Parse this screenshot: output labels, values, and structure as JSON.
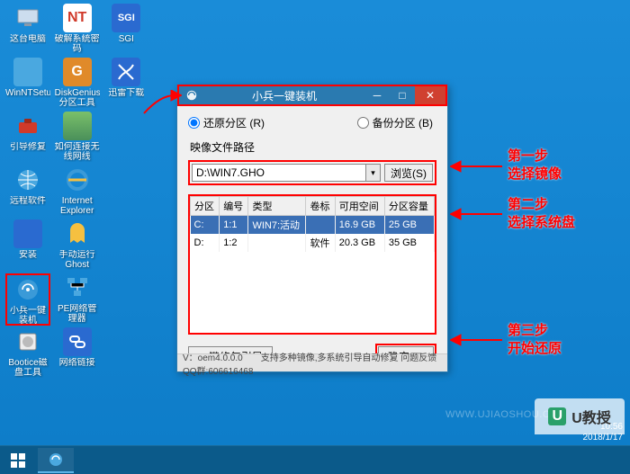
{
  "desktop_icons": [
    {
      "name": "this-pc",
      "label": "这台电脑",
      "glyph": "pc"
    },
    {
      "name": "winntsetup",
      "label": "WinNTSetup",
      "glyph": "blue"
    },
    {
      "name": "boot-repair",
      "label": "引导修复",
      "glyph": "toolbox"
    },
    {
      "name": "remote-soft",
      "label": "远程软件",
      "glyph": "globe"
    },
    {
      "name": "install",
      "label": "安装",
      "glyph": "win7"
    },
    {
      "name": "xiaobing",
      "label": "小兵一键装机",
      "glyph": "xb"
    },
    {
      "name": "bootice",
      "label": "Bootice磁盘工具",
      "glyph": "disk"
    },
    {
      "name": "crack-pwd",
      "label": "破解系统密码",
      "glyph": "nt"
    },
    {
      "name": "diskgenius",
      "label": "DiskGenius分区工具",
      "glyph": "dg"
    },
    {
      "name": "wifi",
      "label": "如何连接无线网线",
      "glyph": "photo"
    },
    {
      "name": "ie",
      "label": "Internet Explorer",
      "glyph": "ie"
    },
    {
      "name": "ghost",
      "label": "手动运行Ghost",
      "glyph": "ghost"
    },
    {
      "name": "pe-network",
      "label": "PE网络管理器",
      "glyph": "net"
    },
    {
      "name": "net-link",
      "label": "网络链接",
      "glyph": "link"
    },
    {
      "name": "sgi",
      "label": "SGI",
      "glyph": "sgi"
    },
    {
      "name": "thunder",
      "label": "迅雷下载",
      "glyph": "xl"
    }
  ],
  "highlighted_icon_index": 5,
  "window": {
    "title": "小兵一键装机",
    "radio_restore": "还原分区 (R)",
    "radio_backup": "备份分区 (B)",
    "path_label": "映像文件路径",
    "path_value": "D:\\WIN7.GHO",
    "browse": "浏览(S)",
    "columns": [
      "分区",
      "编号",
      "类型",
      "卷标",
      "可用空间",
      "分区容量"
    ],
    "rows": [
      {
        "part": "C:",
        "num": "1:1",
        "type": "WIN7:活动",
        "vol": "",
        "free": "16.9 GB",
        "size": "25 GB",
        "selected": true
      },
      {
        "part": "D:",
        "num": "1:2",
        "type": "",
        "vol": "软件",
        "free": "20.3 GB",
        "size": "35 GB",
        "selected": false
      }
    ],
    "repair_btn": "一键修复引导",
    "ok_btn": "确定(Y)",
    "status": "V：oem4.0.0.0　　支持多种镜像,多系统引导自动修复 问题反馈QQ群:606616468"
  },
  "annotations": [
    {
      "l1": "第一步",
      "l2": "选择镜像"
    },
    {
      "l1": "第二步",
      "l2": "选择系统盘"
    },
    {
      "l1": "第三步",
      "l2": "开始还原"
    }
  ],
  "watermark_text": "WWW.UJIAOSHOU.COM",
  "datetime": {
    "time": "10:56",
    "date": "2018/1/17"
  },
  "logo_text": "U教授"
}
